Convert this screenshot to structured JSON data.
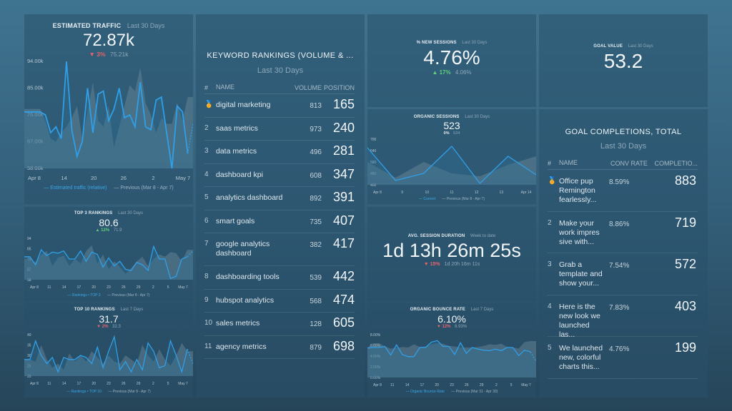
{
  "widgets": {
    "estimated_traffic": {
      "title": "ESTIMATED TRAFFIC",
      "period": "Last 30 Days",
      "value": "72.87k",
      "delta_arrow": "▼",
      "delta": "3%",
      "previous": "75.21k",
      "legend_current": "Estimated traffic (relative)",
      "legend_previous": "Previous (Mar 8 - Apr 7)"
    },
    "top3": {
      "title": "TOP 3 RANKINGS",
      "period": "Last 30 Days",
      "value": "80.6",
      "delta_arrow": "▲",
      "delta": "12%",
      "previous": "71.9",
      "legend_current": "Rankings • TOP 3",
      "legend_previous": "Previous (Mar 8 - Apr 7)"
    },
    "top10": {
      "title": "TOP 10 RANKINGS",
      "period": "Last 7 Days",
      "value": "31.7",
      "delta_arrow": "▼",
      "delta": "2%",
      "previous": "32.3",
      "legend_current": "Rankings • TOP 10",
      "legend_previous": "Previous (Mar 8 - Apr 7)"
    },
    "keywords": {
      "title": "KEYWORD RANKINGS (VOLUME & ...",
      "period": "Last 30 Days",
      "columns": [
        "#",
        "NAME",
        "VOLUME",
        "POSITION"
      ],
      "rows": [
        {
          "rank": "🏅",
          "name": "digital marketing",
          "volume": "813",
          "position": "165"
        },
        {
          "rank": "2",
          "name": "saas metrics",
          "volume": "973",
          "position": "240"
        },
        {
          "rank": "3",
          "name": "data metrics",
          "volume": "496",
          "position": "281"
        },
        {
          "rank": "4",
          "name": "dashboard kpi",
          "volume": "608",
          "position": "347"
        },
        {
          "rank": "5",
          "name": "analytics dashboard",
          "volume": "892",
          "position": "391"
        },
        {
          "rank": "6",
          "name": "smart goals",
          "volume": "735",
          "position": "407"
        },
        {
          "rank": "7",
          "name": "google analytics dashboard",
          "volume": "382",
          "position": "417"
        },
        {
          "rank": "8",
          "name": "dashboarding tools",
          "volume": "539",
          "position": "442"
        },
        {
          "rank": "9",
          "name": "hubspot analytics",
          "volume": "568",
          "position": "474"
        },
        {
          "rank": "10",
          "name": "sales metrics",
          "volume": "128",
          "position": "605"
        },
        {
          "rank": "11",
          "name": "agency metrics",
          "volume": "879",
          "position": "698"
        }
      ]
    },
    "new_sessions": {
      "title": "% NEW SESSIONS",
      "period": "Last 30 Days",
      "value": "4.76%",
      "delta_arrow": "▲",
      "delta": "17%",
      "previous": "4.06%"
    },
    "organic_sessions": {
      "title": "ORGANIC SESSIONS",
      "period": "Last 30 Days",
      "value": "523",
      "delta": "0%",
      "previous": "524",
      "legend_current": "Current",
      "legend_previous": "Previous (Mar 8 - Apr 7)"
    },
    "session_duration": {
      "title": "AVG. SESSION DURATION",
      "period": "Week to date",
      "value": "1d 13h 26m 25s",
      "delta_arrow": "▼",
      "delta": "15%",
      "previous": "1d 20h 16m 11s"
    },
    "bounce_rate": {
      "title": "ORGANIC BOUNCE RATE",
      "period": "Last 7 Days",
      "value": "6.10%",
      "delta_arrow": "▼",
      "delta": "12%",
      "previous": "6.93%",
      "legend_current": "Organic Bounce Rate",
      "legend_previous": "Previous (Mar 31 - Apr 30)"
    },
    "goal_value": {
      "title": "GOAL VALUE",
      "period": "Last 30 Days",
      "value": "53.2"
    },
    "goal_completions": {
      "title": "GOAL COMPLETIONS, TOTAL",
      "period": "Last 30 Days",
      "columns": [
        "#",
        "NAME",
        "CONV RATE",
        "COMPLETIO..."
      ],
      "rows": [
        {
          "rank": "🏅",
          "name": "Office pup Remington fearlessly...",
          "rate": "8.59%",
          "completions": "883"
        },
        {
          "rank": "2",
          "name": "Make your work impres sive with...",
          "rate": "8.86%",
          "completions": "719"
        },
        {
          "rank": "3",
          "name": "Grab a template and show your...",
          "rate": "7.54%",
          "completions": "572"
        },
        {
          "rank": "4",
          "name": "Here is the new look we launched las...",
          "rate": "7.83%",
          "completions": "403"
        },
        {
          "rank": "5",
          "name": "We launched new, colorful charts this...",
          "rate": "4.76%",
          "completions": "199"
        }
      ]
    }
  },
  "colors": {
    "current_line": "#2f9fe8",
    "previous_area": "#6f8c9c",
    "delta_down": "#e8636b",
    "delta_up": "#5fcf7d"
  },
  "chart_data": [
    {
      "id": "estimated_traffic",
      "type": "line",
      "title": "ESTIMATED TRAFFIC",
      "yticks": [
        "94.00k",
        "85.00k",
        "76.00k",
        "67.00k",
        "58.00k"
      ],
      "ylim": [
        58000,
        94000
      ],
      "xticks": [
        "Apr 8",
        "14",
        "20",
        "26",
        "2",
        "May 7"
      ],
      "series": [
        {
          "name": "Estimated traffic (relative)",
          "values": [
            77000,
            77000,
            77000,
            77000,
            76000,
            70000,
            72000,
            68000,
            94000,
            71000,
            62000,
            67000,
            85000,
            70000,
            83000,
            84000,
            74000,
            78000,
            85000,
            75000,
            76000,
            72000,
            87000,
            72000,
            71000,
            81000,
            82000,
            70000,
            58000,
            79000,
            77000,
            63000,
            73000
          ]
        },
        {
          "name": "Previous (Mar 8 - Apr 7)",
          "values": [
            78000,
            78000,
            78000,
            78000,
            74000,
            68000,
            67000,
            70000,
            72000,
            75000,
            79000,
            68000,
            77000,
            87000,
            74000,
            72000,
            79000,
            65000,
            72000,
            79000,
            86000,
            84000,
            92000,
            80000,
            76000,
            70000,
            75000,
            73000,
            73000,
            80000,
            74000,
            82000,
            82000
          ]
        }
      ]
    },
    {
      "id": "top3",
      "type": "line",
      "title": "TOP 3 RANKINGS",
      "yticks": [
        "94",
        "85",
        "76",
        "67",
        "58"
      ],
      "ylim": [
        58,
        94
      ],
      "xticks": [
        "Apr 8",
        "11",
        "14",
        "17",
        "20",
        "23",
        "26",
        "29",
        "2",
        "5",
        "May 7"
      ],
      "series": [
        {
          "name": "Rankings • TOP 3",
          "values": [
            78,
            78,
            71,
            84,
            79,
            82,
            81,
            83,
            76,
            76,
            83,
            74,
            82,
            80,
            69,
            77,
            70,
            74,
            67,
            66,
            73,
            71,
            66,
            87,
            76,
            76,
            59,
            61,
            76,
            78,
            83
          ]
        },
        {
          "name": "Previous (Mar 8 - Apr 7)",
          "values": [
            76,
            76,
            73,
            80,
            83,
            70,
            77,
            79,
            70,
            76,
            72,
            83,
            88,
            72,
            80,
            67,
            74,
            69,
            63,
            68,
            74,
            78,
            70,
            76,
            80,
            78,
            82,
            81,
            74,
            84,
            84
          ]
        }
      ]
    },
    {
      "id": "top10",
      "type": "line",
      "title": "TOP 10 RANKINGS",
      "yticks": [
        "40",
        "35",
        "30",
        "25",
        "20"
      ],
      "ylim": [
        20,
        40
      ],
      "xticks": [
        "Apr 8",
        "11",
        "14",
        "17",
        "20",
        "23",
        "26",
        "29",
        "2",
        "5",
        "May 7"
      ],
      "series": [
        {
          "name": "Rankings • TOP 10",
          "values": [
            28,
            28,
            37,
            30,
            26,
            29,
            22,
            29,
            28,
            28,
            30,
            29,
            26,
            34,
            24,
            32,
            39,
            23,
            27,
            22,
            28,
            23,
            36,
            32,
            24,
            25,
            37,
            30,
            22,
            33,
            26
          ]
        },
        {
          "name": "Previous (Mar 8 - Apr 7)",
          "values": [
            28,
            28,
            27,
            35,
            28,
            24,
            26,
            23,
            31,
            27,
            30,
            27,
            32,
            29,
            26,
            30,
            27,
            26,
            30,
            28,
            26,
            35,
            30,
            27,
            33,
            28,
            25,
            30,
            36,
            32,
            32
          ]
        }
      ]
    },
    {
      "id": "organic_sessions",
      "type": "line",
      "title": "ORGANIC SESSIONS",
      "yticks": [
        "700",
        "640",
        "580",
        "480",
        "400"
      ],
      "ylim": [
        400,
        720
      ],
      "xticks": [
        "Apr 8",
        "9",
        "10",
        "11",
        "12",
        "13",
        "Apr 14"
      ],
      "series": [
        {
          "name": "Current",
          "values": [
            660,
            430,
            480,
            670,
            410,
            600,
            470
          ]
        },
        {
          "name": "Previous (Mar 8 - Apr 7)",
          "values": [
            560,
            450,
            560,
            480,
            460,
            540,
            600
          ]
        }
      ]
    },
    {
      "id": "bounce_rate",
      "type": "line",
      "title": "ORGANIC BOUNCE RATE",
      "yticks": [
        "8.00%",
        "6.00%",
        "4.00%",
        "2.00%",
        "0.00%"
      ],
      "ylim": [
        0,
        8
      ],
      "xticks": [
        "Apr 8",
        "11",
        "14",
        "17",
        "20",
        "23",
        "26",
        "29",
        "2",
        "5",
        "May 7"
      ],
      "series": [
        {
          "name": "Organic Bounce Rate",
          "values": [
            5.5,
            5.6,
            5.6,
            5.8,
            4.2,
            6.1,
            4.3,
            3.9,
            3.9,
            5.6,
            5.6,
            6.6,
            6.9,
            5.8,
            5.8,
            4.3,
            6.5,
            4.5,
            5.6,
            5.3,
            5.1,
            5.0,
            5.3,
            5.0,
            5.6,
            5.6,
            4.1,
            5.1,
            4.8,
            3.0
          ]
        },
        {
          "name": "Previous (Mar 31 - Apr 30)",
          "values": [
            5.6,
            6.4,
            6.4,
            5.8,
            5.4,
            5.5,
            5.7,
            5.6,
            6.2,
            5.7,
            5.8,
            6.2,
            6.4,
            6.3,
            5.9,
            5.8,
            5.6,
            5.6,
            5.6,
            5.7,
            5.9,
            6.2,
            6.1,
            6.3,
            5.7,
            5.6,
            5.4,
            6.6,
            6.8,
            6.8
          ]
        }
      ]
    }
  ]
}
